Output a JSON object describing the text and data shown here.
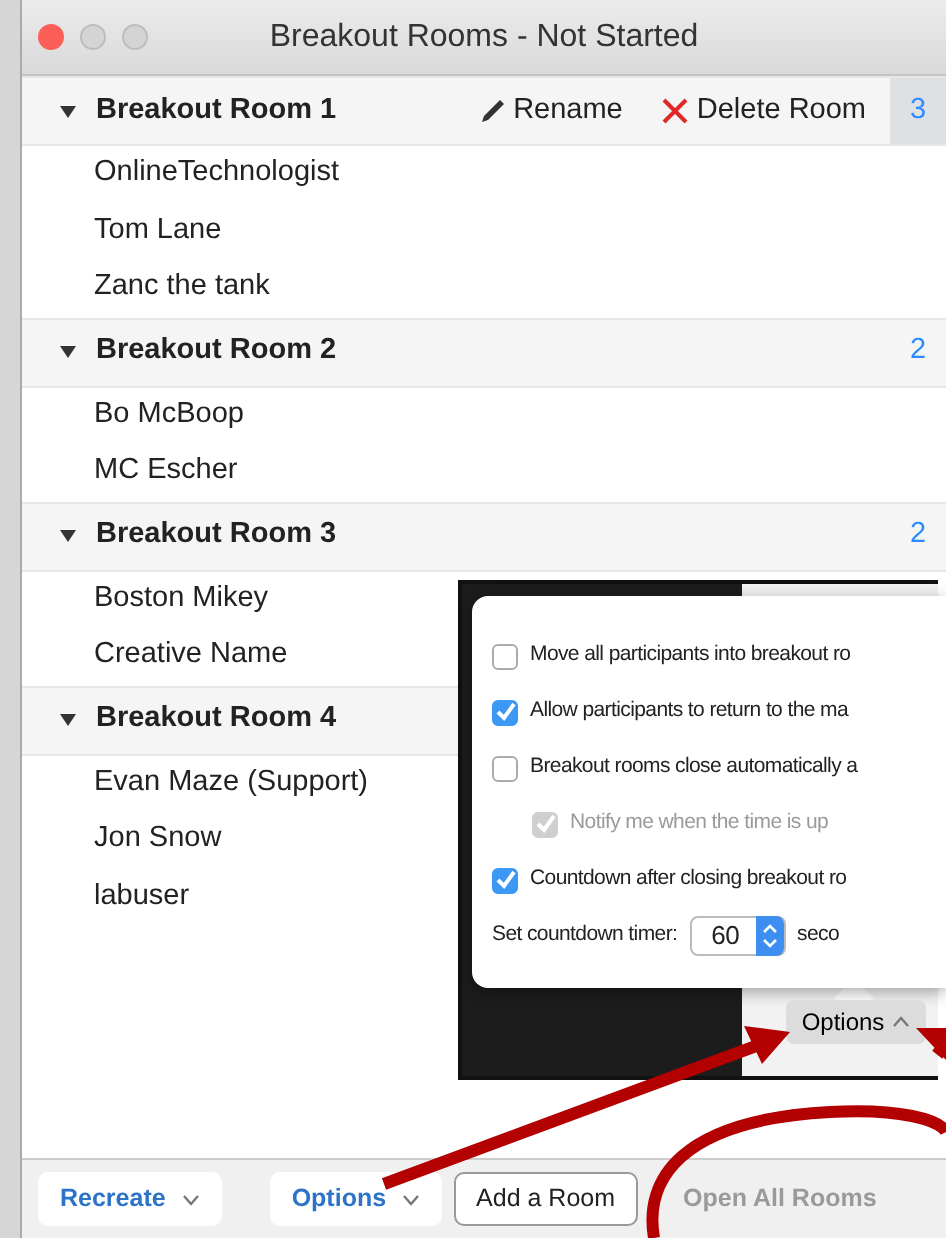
{
  "window": {
    "title": "Breakout Rooms - Not Started"
  },
  "rooms": [
    {
      "name": "Breakout Room 1",
      "expanded": true,
      "highlighted": true,
      "count": "3",
      "actions": [
        {
          "kind": "rename",
          "label": "Rename"
        },
        {
          "kind": "delete",
          "label": "Delete Room"
        }
      ],
      "participants": [
        "OnlineTechnologist",
        "Tom Lane",
        "Zanc the tank"
      ]
    },
    {
      "name": "Breakout Room 2",
      "expanded": true,
      "highlighted": false,
      "count": "2",
      "participants": [
        "Bo McBoop",
        "MC Escher"
      ]
    },
    {
      "name": "Breakout Room 3",
      "expanded": true,
      "highlighted": false,
      "count": "2",
      "participants": [
        "Boston Mikey",
        "Creative Name"
      ]
    },
    {
      "name": "Breakout Room 4",
      "expanded": true,
      "highlighted": false,
      "participants": [
        "Evan Maze (Support)",
        "Jon Snow",
        "labuser"
      ]
    }
  ],
  "options_popover": {
    "items": [
      {
        "kind": "checkbox",
        "label": "Move all participants into breakout ro",
        "checked": false,
        "disabled": false
      },
      {
        "kind": "checkbox",
        "label": "Allow participants to return to the ma",
        "checked": true,
        "disabled": false
      },
      {
        "kind": "checkbox",
        "label": "Breakout rooms close automatically a",
        "checked": false,
        "disabled": false,
        "children": [
          {
            "kind": "checkbox",
            "label": "Notify me when the time is up",
            "checked": true,
            "disabled": true
          }
        ]
      },
      {
        "kind": "checkbox",
        "label": "Countdown after closing breakout ro",
        "checked": true,
        "disabled": false
      },
      {
        "kind": "timer",
        "label": "Set countdown timer:",
        "value": "60",
        "unit": "seco"
      }
    ],
    "button": "Options"
  },
  "footer": {
    "buttons": [
      {
        "kind": "menu",
        "label": "Recreate",
        "disabled": false
      },
      {
        "kind": "menu",
        "label": "Options",
        "disabled": false
      },
      {
        "kind": "outline",
        "label": "Add a Room",
        "disabled": false
      },
      {
        "kind": "plain",
        "label": "Open All Rooms",
        "disabled": true
      }
    ]
  }
}
